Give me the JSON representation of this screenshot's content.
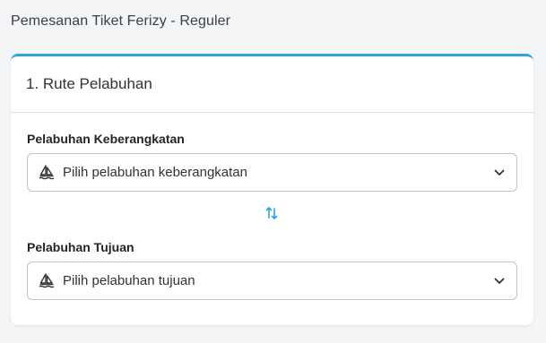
{
  "page": {
    "title": "Pemesanan Tiket Ferizy - Reguler"
  },
  "section": {
    "title": "1. Rute Pelabuhan"
  },
  "departure": {
    "label": "Pelabuhan Keberangkatan",
    "placeholder": "Pilih pelabuhan keberangkatan",
    "icon": "ship-icon"
  },
  "destination": {
    "label": "Pelabuhan Tujuan",
    "placeholder": "Pilih pelabuhan tujuan",
    "icon": "ship-icon"
  },
  "swap": {
    "icon": "swap-arrows-icon"
  },
  "colors": {
    "accent": "#2ea3de",
    "border": "#bfc4c9",
    "background": "#f4f5f7"
  }
}
